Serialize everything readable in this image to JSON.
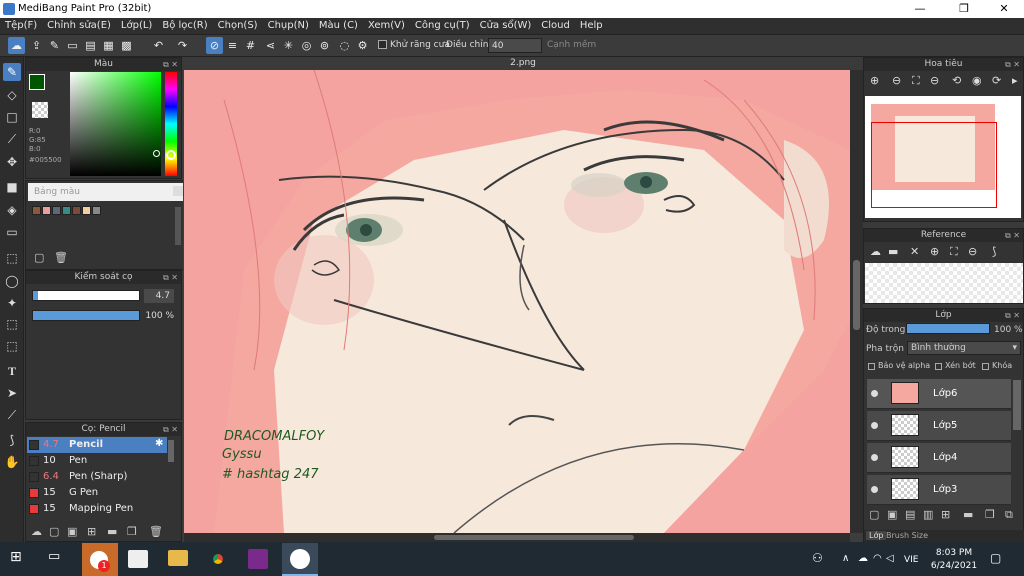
{
  "window": {
    "title": "MediBang Paint Pro (32bit)",
    "minimize": "—",
    "restore": "❐",
    "close": "✕"
  },
  "menu": [
    "Tệp(F)",
    "Chỉnh sửa(E)",
    "Lớp(L)",
    "Bộ lọc(R)",
    "Chọn(S)",
    "Chụp(N)",
    "Màu (C)",
    "Xem(V)",
    "Công cụ(T)",
    "Cửa sổ(W)",
    "Cloud",
    "Help"
  ],
  "toolbar": {
    "antialias_label": "Khử răng cưa",
    "adjust_label": "Điều chỉnh",
    "adjust_value": "40",
    "smooth_label": "Cạnh mềm"
  },
  "document_tab": "2.png",
  "color_panel": {
    "title": "Màu",
    "r": "R:0",
    "g": "G:85",
    "b": "B:0",
    "hex": "#005500",
    "fg_color": "#005500"
  },
  "palette_panel": {
    "title": "Bảng màu",
    "swatches": [
      "#8b5a3c",
      "#e8a0a0",
      "#5a6a7a",
      "#3a8a8a",
      "#7a4a3a",
      "#f0d0a0",
      "#888888"
    ]
  },
  "brush_control": {
    "title": "Kiểm soát cọ",
    "size_value": "4.7",
    "opacity_value": "100 %"
  },
  "brush_panel": {
    "title": "Cọ: Pencil",
    "items": [
      {
        "size": "4.7",
        "name": "Pencil",
        "color": "#333333"
      },
      {
        "size": "10",
        "name": "Pen",
        "color": "#333333"
      },
      {
        "size": "6.4",
        "name": "Pen (Sharp)",
        "color": "#333333"
      },
      {
        "size": "15",
        "name": "G Pen",
        "color": "#e83a3a"
      },
      {
        "size": "15",
        "name": "Mapping Pen",
        "color": "#e83a3a"
      }
    ]
  },
  "navigator": {
    "title": "Hoa tiêu"
  },
  "reference": {
    "title": "Reference"
  },
  "layer_panel": {
    "title": "Lớp",
    "opacity_label": "Độ trong",
    "opacity_value": "100 %",
    "blend_label": "Pha trộn",
    "blend_value": "Bình thường",
    "protect_alpha": "Bảo vệ alpha",
    "clip": "Xén bớt",
    "lock": "Khóa",
    "layers": [
      "Lớp6",
      "Lớp5",
      "Lớp4",
      "Lớp3"
    ],
    "bottom_tabs": [
      "Lớp",
      "Brush Size"
    ]
  },
  "canvas_text": {
    "line1": "DRACOMALFOY",
    "line2": "Gyssu",
    "line3": "# hashtag 247"
  },
  "taskbar": {
    "time": "8:03 PM",
    "date": "6/24/2021",
    "lang": "VIE",
    "badge": "1"
  }
}
